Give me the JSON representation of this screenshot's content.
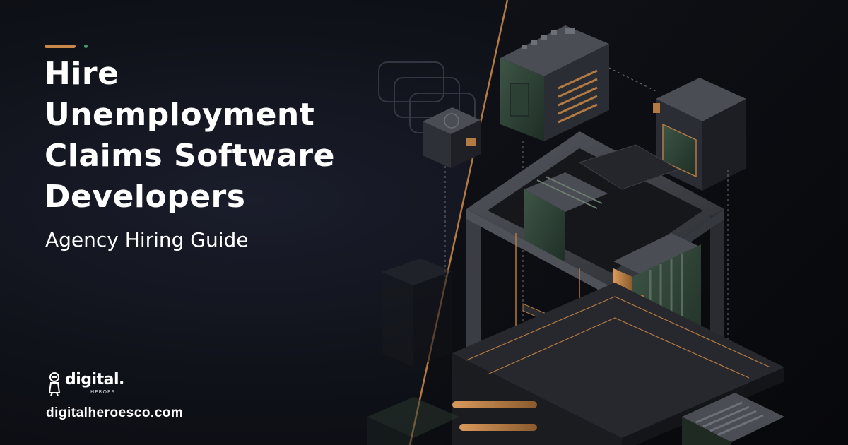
{
  "hero": {
    "title": "Hire Unemployment Claims Software Developers",
    "subtitle": "Agency Hiring Guide"
  },
  "brand": {
    "logo_word": "digital.",
    "logo_sub": "HEROES",
    "website": "digitalheroesco.com"
  },
  "colors": {
    "background": "#0d0f14",
    "accent_copper": "#c9874a",
    "accent_green": "#4a9a6a",
    "module_green": "#2c4034",
    "frame_gray": "#3a3d44"
  },
  "illustration": {
    "subject": "isometric server rack frame with green and copper modules"
  }
}
